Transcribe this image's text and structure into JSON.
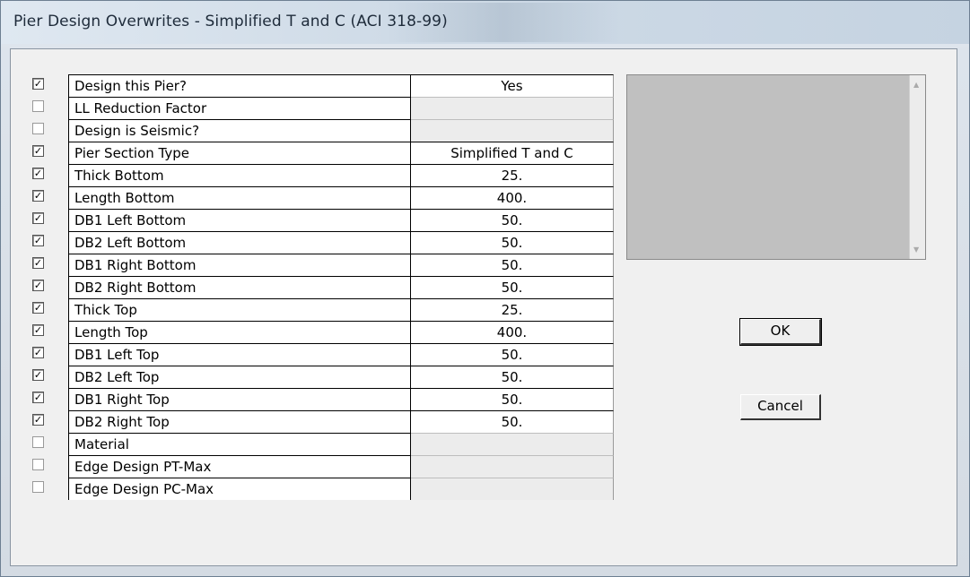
{
  "window": {
    "title": "Pier Design Overwrites - Simplified T and C (ACI 318-99)"
  },
  "rows": [
    {
      "checked": true,
      "label": "Design this Pier?",
      "value": "Yes"
    },
    {
      "checked": false,
      "label": "LL Reduction Factor",
      "value": ""
    },
    {
      "checked": false,
      "label": "Design is Seismic?",
      "value": ""
    },
    {
      "checked": true,
      "label": "Pier Section Type",
      "value": "Simplified T and C"
    },
    {
      "checked": true,
      "label": "Thick Bottom",
      "value": "25."
    },
    {
      "checked": true,
      "label": "Length Bottom",
      "value": "400."
    },
    {
      "checked": true,
      "label": "DB1 Left Bottom",
      "value": "50."
    },
    {
      "checked": true,
      "label": "DB2 Left Bottom",
      "value": "50."
    },
    {
      "checked": true,
      "label": "DB1 Right Bottom",
      "value": "50."
    },
    {
      "checked": true,
      "label": "DB2 Right Bottom",
      "value": "50."
    },
    {
      "checked": true,
      "label": "Thick Top",
      "value": "25."
    },
    {
      "checked": true,
      "label": "Length Top",
      "value": "400."
    },
    {
      "checked": true,
      "label": "DB1 Left Top",
      "value": "50."
    },
    {
      "checked": true,
      "label": "DB2 Left Top",
      "value": "50."
    },
    {
      "checked": true,
      "label": "DB1 Right Top",
      "value": "50."
    },
    {
      "checked": true,
      "label": "DB2 Right Top",
      "value": "50."
    },
    {
      "checked": false,
      "label": "Material",
      "value": ""
    },
    {
      "checked": false,
      "label": "Edge Design PT-Max",
      "value": ""
    },
    {
      "checked": false,
      "label": "Edge Design PC-Max",
      "value": ""
    }
  ],
  "buttons": {
    "ok": "OK",
    "cancel": "Cancel"
  },
  "icons": {
    "check": "checkmark-icon",
    "scroll_up": "scroll-up-arrow-icon",
    "scroll_down": "scroll-down-arrow-icon"
  }
}
